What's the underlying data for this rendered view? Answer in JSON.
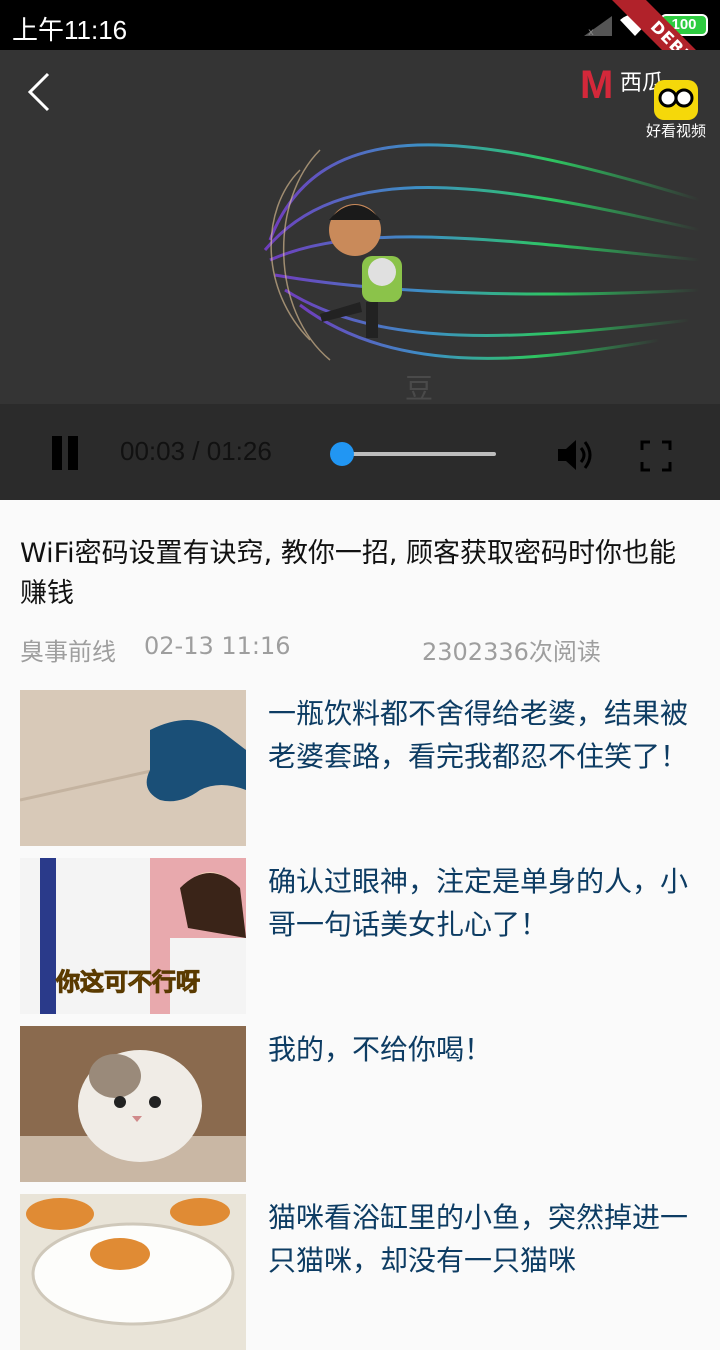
{
  "status_bar": {
    "time": "上午11:16",
    "battery": "100",
    "debug_label": "DEBUG"
  },
  "video": {
    "watermark_top": "西瓜",
    "logo_caption": "好看视频"
  },
  "controls": {
    "time_display": "00:03 / 01:26",
    "progress": 0.0
  },
  "article": {
    "title": "WiFi密码设置有诀窍, 教你一招, 顾客获取密码时你也能赚钱",
    "source": "臭事前线",
    "date": "02-13 11:16",
    "reads": "2302336次阅读"
  },
  "recommendations": [
    {
      "title": "一瓶饮料都不舍得给老婆，结果被老婆套路，看完我都忍不住笑了！",
      "caption": ""
    },
    {
      "title": "确认过眼神，注定是单身的人，小哥一句话美女扎心了！",
      "caption": "你这可不行呀"
    },
    {
      "title": "我的，不给你喝！",
      "caption": ""
    },
    {
      "title": "猫咪看浴缸里的小鱼，突然掉进一只猫咪，却没有一只猫咪",
      "caption": ""
    }
  ],
  "colors": {
    "accent": "#2196f3",
    "rec_title": "#0d3c63",
    "meta": "#9e9e9e"
  }
}
